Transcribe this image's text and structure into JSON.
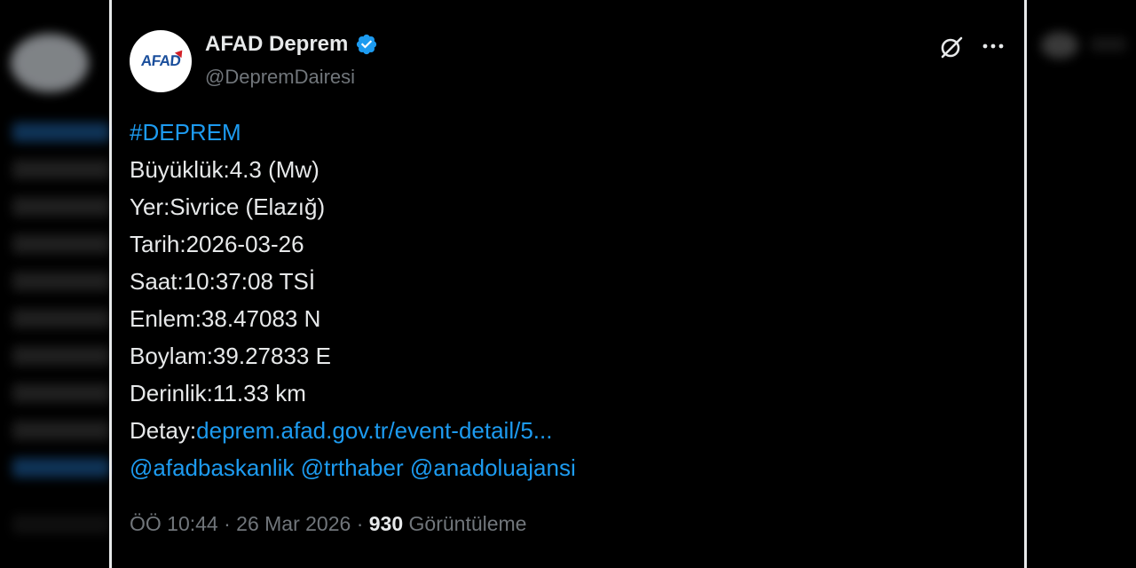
{
  "colors": {
    "background": "#000000",
    "text": "#e7e9ea",
    "secondary": "#71767b",
    "link": "#1d9bf0",
    "verified": "#1d9bf0",
    "brand_blue": "#1b4f9c",
    "brand_red": "#d32027"
  },
  "author": {
    "avatar_logo": "AFAD",
    "display_name": "AFAD Deprem",
    "verified_icon": "verified-badge-icon",
    "handle": "@DepremDairesi"
  },
  "actions": {
    "grok_icon": "grok-icon",
    "more_icon": "more-icon"
  },
  "tweet": {
    "hashtag": "#DEPREM",
    "magnitude": "Büyüklük:4.3 (Mw)",
    "location": "Yer:Sivrice (Elazığ)",
    "date": "Tarih:2026-03-26",
    "time": "Saat:10:37:08 TSİ",
    "latitude": "Enlem:38.47083 N",
    "longitude": "Boylam:39.27833 E",
    "depth": "Derinlik:11.33 km",
    "detail_label": "Detay:",
    "detail_link": "deprem.afad.gov.tr/event-detail/5...",
    "mentions": [
      "@afadbaskanlik",
      "@trthaber",
      "@anadoluajansi"
    ]
  },
  "meta": {
    "timestamp": "ÖÖ 10:44 · 26 Mar 2026 · ",
    "views_count": "930",
    "views_label": " Görüntüleme"
  }
}
